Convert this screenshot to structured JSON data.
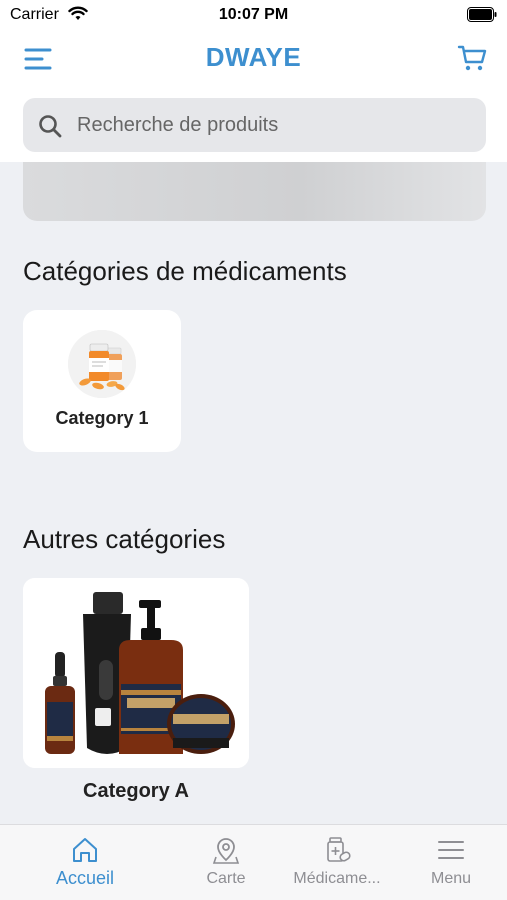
{
  "status_bar": {
    "carrier": "Carrier",
    "time": "10:07 PM"
  },
  "header": {
    "title": "DWAYE"
  },
  "search": {
    "placeholder": "Recherche de produits"
  },
  "sections": {
    "medicine_title": "Catégories de médicaments",
    "other_title": "Autres catégories"
  },
  "medicine_categories": [
    {
      "label": "Category 1",
      "image": "pill-bottles-image"
    }
  ],
  "other_categories": [
    {
      "label": "Category A",
      "image": "grooming-products-image"
    }
  ],
  "tabbar": {
    "items": [
      {
        "label": "Accueil",
        "icon": "home-icon",
        "active": true
      },
      {
        "label": "Carte",
        "icon": "map-pin-icon",
        "active": false
      },
      {
        "label": "Médicame...",
        "icon": "medicine-icon",
        "active": false
      },
      {
        "label": "Menu",
        "icon": "hamburger-icon",
        "active": false
      }
    ]
  },
  "colors": {
    "accent": "#3d8fcf",
    "background": "#eef0f4",
    "inactive": "#8e8e93"
  }
}
